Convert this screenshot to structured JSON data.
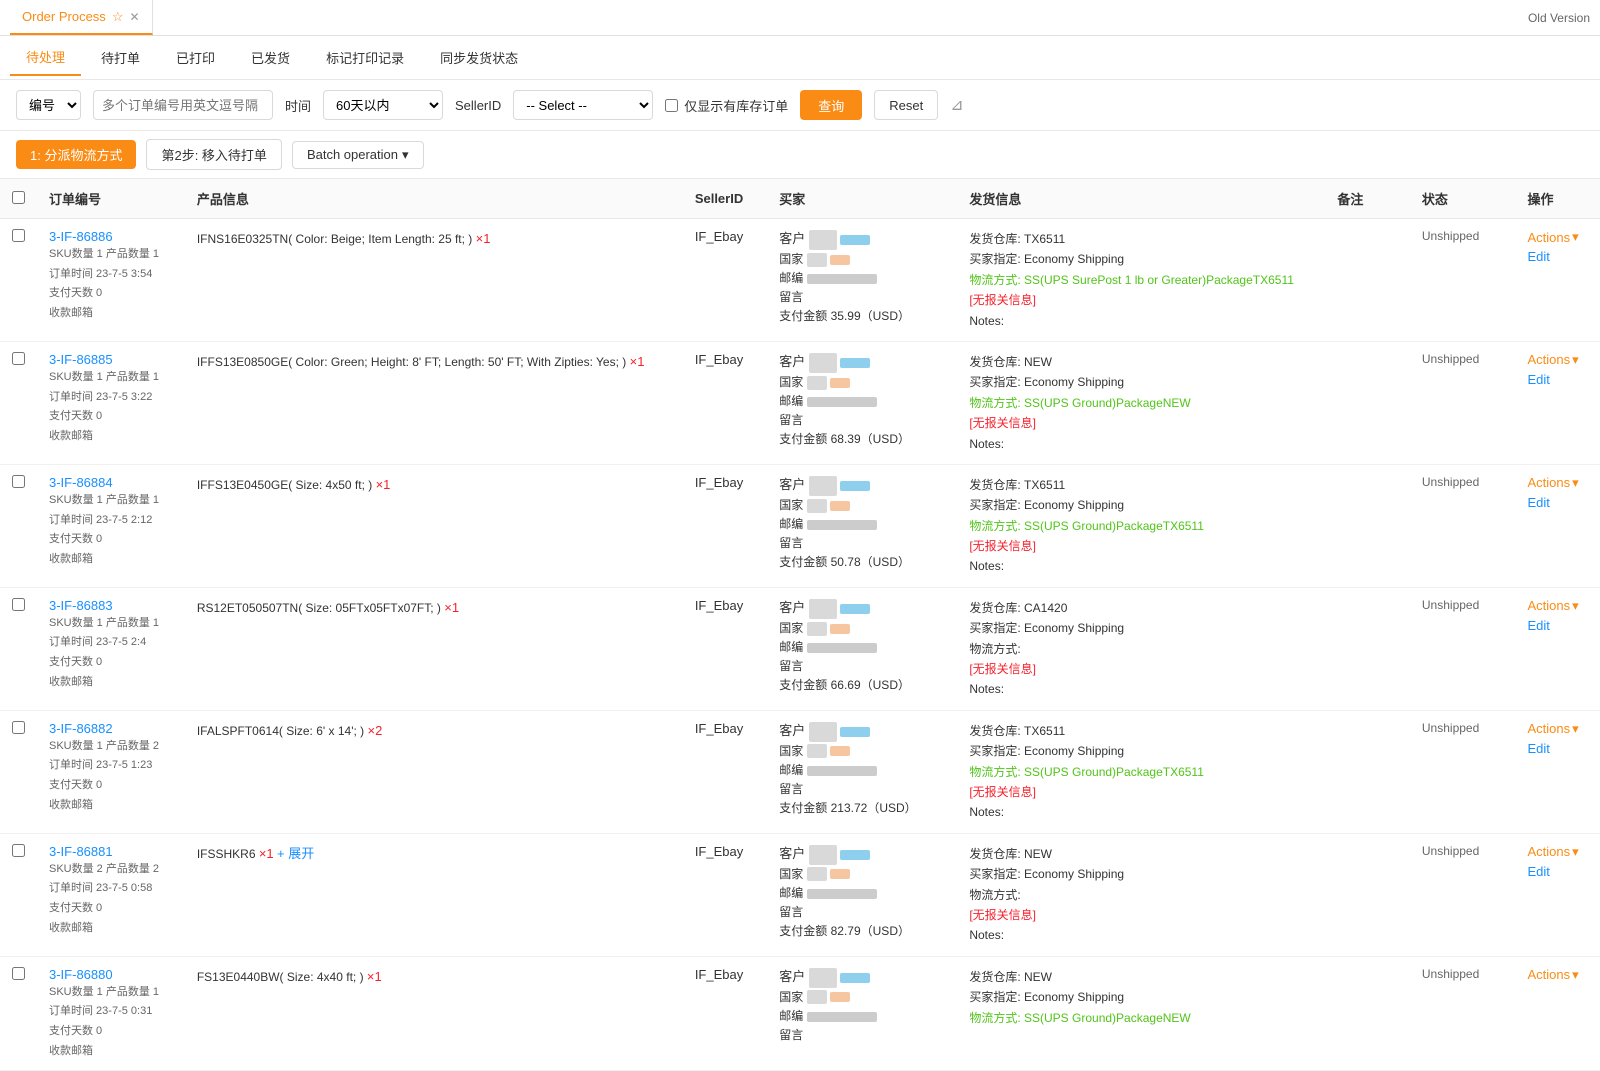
{
  "app": {
    "tab_title": "Order Process",
    "old_version_label": "Old Version"
  },
  "nav_tabs": [
    {
      "id": "待处理",
      "label": "待处理",
      "active": true
    },
    {
      "id": "待打单",
      "label": "待打单",
      "active": false
    },
    {
      "id": "已打印",
      "label": "已打印",
      "active": false
    },
    {
      "id": "已发货",
      "label": "已发货",
      "active": false
    },
    {
      "id": "标记打印记录",
      "label": "标记打印记录",
      "active": false
    },
    {
      "id": "同步发货状态",
      "label": "同步发货状态",
      "active": false
    }
  ],
  "filters": {
    "order_num_placeholder": "多个订单编号用英文逗号隔",
    "time_label": "时间",
    "time_option": "60天以内",
    "seller_id_label": "SellerID",
    "select_placeholder": "-- Select --",
    "stock_only_label": "仅显示有库存订单",
    "search_btn": "查询",
    "reset_btn": "Reset"
  },
  "actions": {
    "step1_label": "1: 分派物流方式",
    "step2_label": "第2步: 移入待打单",
    "batch_label": "Batch operation"
  },
  "table": {
    "headers": [
      "",
      "订单编号",
      "产品信息",
      "SellerID",
      "买家",
      "发货信息",
      "备注",
      "状态",
      "操作"
    ],
    "rows": [
      {
        "order_id": "3-IF-86886",
        "sku": "SKU数量 1  产品数量 1",
        "order_time": "订单时间 23-7-5 3:54",
        "pay_days": "支付天数 0",
        "email": "收款邮箱",
        "product": "IFNS16E0325TN( Color: Beige; Item Length: 25 ft; ) ×1",
        "product_highlight": "×1",
        "seller_id": "IF_Ebay",
        "buyer_amount": "支付金额 35.99（USD）",
        "ship_warehouse": "发货仓库: TX6511",
        "ship_buyer": "买家指定: Economy Shipping",
        "ship_method": "物流方式: SS(UPS SurePost 1 lb or Greater)PackageTX6511",
        "ship_no_info": "[无报关信息]",
        "ship_notes": "Notes:",
        "status": "Unshipped",
        "actions_label": "Actions",
        "edit_label": "Edit"
      },
      {
        "order_id": "3-IF-86885",
        "sku": "SKU数量 1  产品数量 1",
        "order_time": "订单时间 23-7-5 3:22",
        "pay_days": "支付天数 0",
        "email": "收款邮箱",
        "product": "IFFS13E0850GE( Color: Green; Height: 8' FT; Length: 50' FT; With Zipties: Yes; ) ×1",
        "product_highlight": "×1",
        "seller_id": "IF_Ebay",
        "buyer_amount": "支付金额 68.39（USD）",
        "ship_warehouse": "发货仓库: NEW",
        "ship_buyer": "买家指定: Economy Shipping",
        "ship_method": "物流方式: SS(UPS Ground)PackageNEW",
        "ship_no_info": "[无报关信息]",
        "ship_notes": "Notes:",
        "status": "Unshipped",
        "actions_label": "Actions",
        "edit_label": "Edit"
      },
      {
        "order_id": "3-IF-86884",
        "sku": "SKU数量 1  产品数量 1",
        "order_time": "订单时间 23-7-5 2:12",
        "pay_days": "支付天数 0",
        "email": "收款邮箱",
        "product": "IFFS13E0450GE( Size: 4x50 ft; ) ×1",
        "product_highlight": "×1",
        "seller_id": "IF_Ebay",
        "buyer_amount": "支付金额 50.78（USD）",
        "ship_warehouse": "发货仓库: TX6511",
        "ship_buyer": "买家指定: Economy Shipping",
        "ship_method": "物流方式: SS(UPS Ground)PackageTX6511",
        "ship_no_info": "[无报关信息]",
        "ship_notes": "Notes:",
        "status": "Unshipped",
        "actions_label": "Actions",
        "edit_label": "Edit"
      },
      {
        "order_id": "3-IF-86883",
        "sku": "SKU数量 1  产品数量 1",
        "order_time": "订单时间 23-7-5 2:4",
        "pay_days": "支付天数 0",
        "email": "收款邮箱",
        "product": "RS12ET050507TN( Size: 05FTx05FTx07FT; ) ×1",
        "product_highlight": "×1",
        "seller_id": "IF_Ebay",
        "buyer_amount": "支付金额 66.69（USD）",
        "ship_warehouse": "发货仓库: CA1420",
        "ship_buyer": "买家指定: Economy Shipping",
        "ship_method": "物流方式:",
        "ship_no_info": "[无报关信息]",
        "ship_notes": "Notes:",
        "status": "Unshipped",
        "actions_label": "Actions",
        "edit_label": "Edit"
      },
      {
        "order_id": "3-IF-86882",
        "sku": "SKU数量 1  产品数量 2",
        "order_time": "订单时间 23-7-5 1:23",
        "pay_days": "支付天数 0",
        "email": "收款邮箱",
        "product": "IFALSPFT0614( Size: 6' x 14'; ) ×2",
        "product_highlight": "×2",
        "seller_id": "IF_Ebay",
        "buyer_amount": "支付金额 213.72（USD）",
        "ship_warehouse": "发货仓库: TX6511",
        "ship_buyer": "买家指定: Economy Shipping",
        "ship_method": "物流方式: SS(UPS Ground)PackageTX6511",
        "ship_no_info": "[无报关信息]",
        "ship_notes": "Notes:",
        "status": "Unshipped",
        "actions_label": "Actions",
        "edit_label": "Edit"
      },
      {
        "order_id": "3-IF-86881",
        "sku": "SKU数量 2  产品数量 2",
        "order_time": "订单时间 23-7-5 0:58",
        "pay_days": "支付天数 0",
        "email": "收款邮箱",
        "product": "IFSSHKR6 ×1",
        "product_extra": "+ 展开",
        "product_highlight": "×1",
        "seller_id": "IF_Ebay",
        "buyer_amount": "支付金额 82.79（USD）",
        "ship_warehouse": "发货仓库: NEW",
        "ship_buyer": "买家指定: Economy Shipping",
        "ship_method": "物流方式:",
        "ship_no_info": "[无报关信息]",
        "ship_notes": "Notes:",
        "status": "Unshipped",
        "actions_label": "Actions",
        "edit_label": "Edit"
      },
      {
        "order_id": "3-IF-86880",
        "sku": "SKU数量 1  产品数量 1",
        "order_time": "订单时间 23-7-5 0:31",
        "pay_days": "支付天数 0",
        "email": "收款邮箱",
        "product": "FS13E0440BW( Size: 4x40 ft; ) ×1",
        "product_highlight": "×1",
        "seller_id": "IF_Ebay",
        "buyer_amount": "",
        "ship_warehouse": "发货仓库: NEW",
        "ship_buyer": "买家指定: Economy Shipping",
        "ship_method": "物流方式: SS(UPS Ground)PackageNEW",
        "ship_no_info": "",
        "ship_notes": "",
        "status": "Unshipped",
        "actions_label": "Actions",
        "edit_label": ""
      }
    ]
  }
}
